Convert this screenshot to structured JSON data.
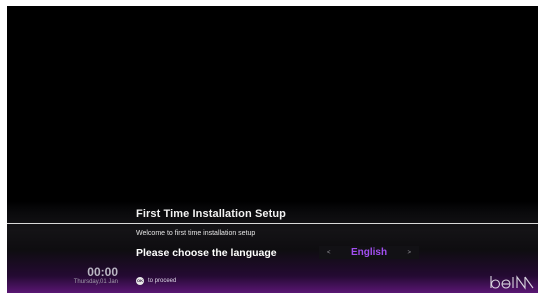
{
  "setup": {
    "title": "First Time Installation Setup",
    "welcome_text": "Welcome to first time installation setup",
    "language_prompt": "Please choose the language",
    "language_value": "English",
    "arrow_left": "<",
    "arrow_right": ">"
  },
  "status": {
    "time": "00:00",
    "date": "Thursday,01 Jan"
  },
  "hint": {
    "button_glyph": "OK",
    "text": "to proceed"
  },
  "brand": {
    "logo_text": "beIN",
    "accent_color": "#a24ff0"
  }
}
